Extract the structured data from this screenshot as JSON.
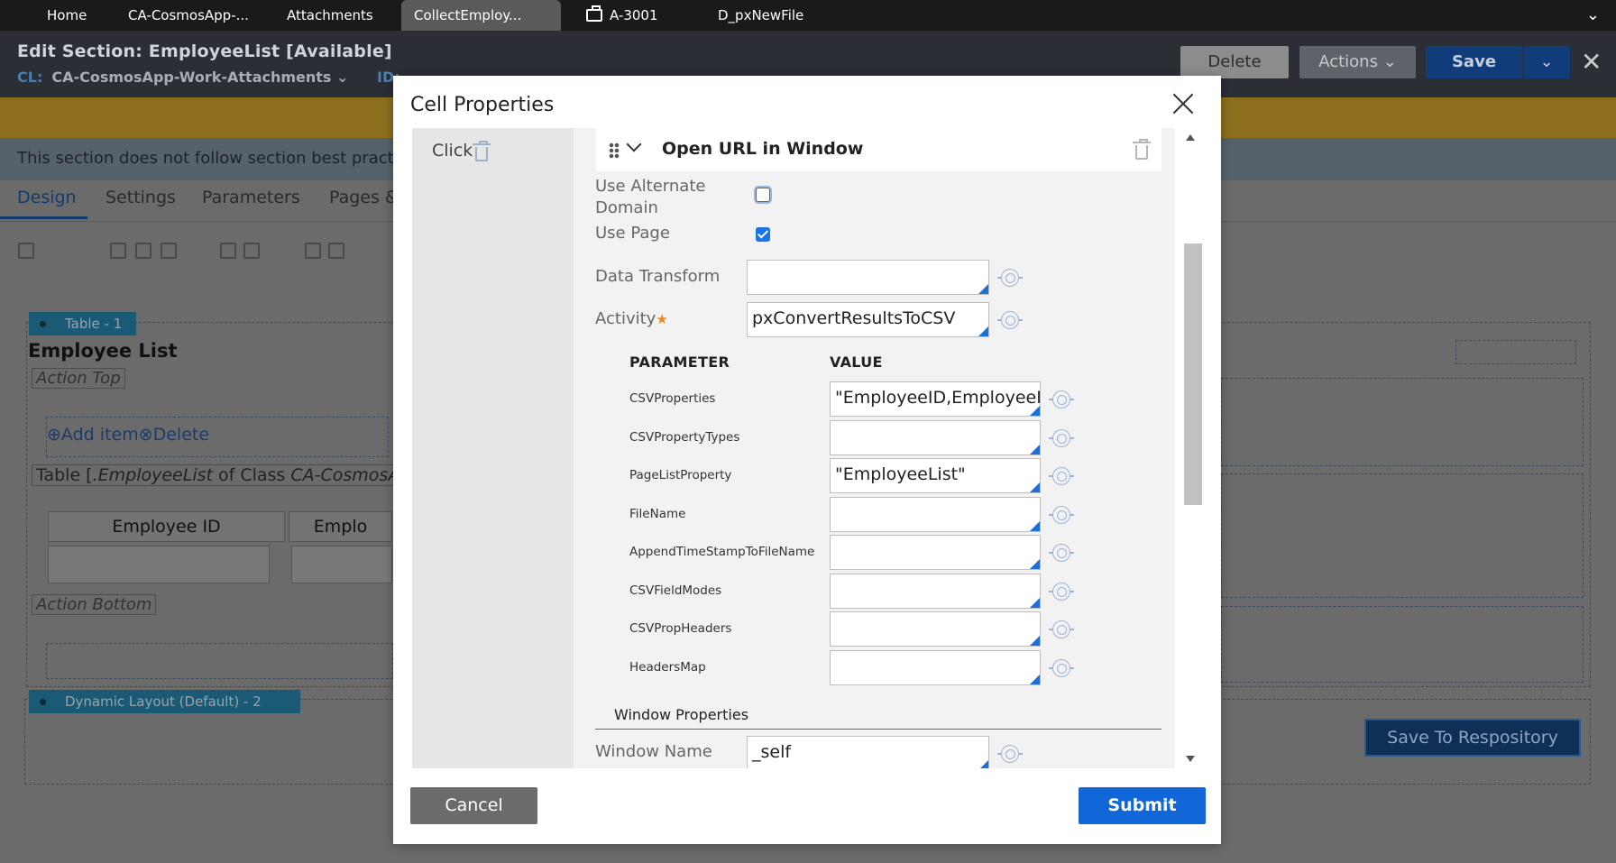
{
  "tabs": [
    {
      "label": "Home"
    },
    {
      "label": "CA-CosmosApp-..."
    },
    {
      "label": "Attachments"
    },
    {
      "label": "CollectEmploy..."
    },
    {
      "label": "A-3001"
    },
    {
      "label": "D_pxNewFile"
    }
  ],
  "header": {
    "title": "Edit  Section: EmployeeList [Available]",
    "cl_key": "CL:",
    "cl_value": "CA-CosmosApp-Work-Attachments",
    "id_key": "ID:",
    "delete_label": "Delete",
    "actions_label": "Actions",
    "save_label": "Save"
  },
  "info_text": "This section does not follow section best practic",
  "subtabs": [
    "Design",
    "Settings",
    "Parameters",
    "Pages &"
  ],
  "background": {
    "table_tag": "Table -    1",
    "employee_list": "Employee List",
    "action_top": "Action Top",
    "add_item": "Add item",
    "delete": "Delete",
    "table_desc_prefix": "Table [",
    "table_desc_prop": ".EmployeeList",
    "table_desc_mid": " of Class ",
    "table_desc_class": "CA-CosmosApp-",
    "col_employee_id": "Employee ID",
    "col_emplo": "Emplo",
    "action_bottom": "Action Bottom",
    "dyn_tag": "Dynamic Layout (Default) -    2",
    "save_repo": "Save To Respository"
  },
  "modal": {
    "title": "Cell Properties",
    "click_label": "Click",
    "action_title": "Open URL in Window",
    "use_alt_domain": "Use Alternate Domain",
    "use_page": "Use Page",
    "data_transform": "Data Transform",
    "data_transform_value": "",
    "activity": "Activity",
    "activity_value": "pxConvertResultsToCSV",
    "param_header": "PARAMETER",
    "value_header": "VALUE",
    "params": [
      {
        "name": "CSVProperties",
        "value": "\"EmployeeID,EmployeeNa"
      },
      {
        "name": "CSVPropertyTypes",
        "value": ""
      },
      {
        "name": "PageListProperty",
        "value": "\"EmployeeList\""
      },
      {
        "name": "FileName",
        "value": ""
      },
      {
        "name": "AppendTimeStampToFileName",
        "value": ""
      },
      {
        "name": "CSVFieldModes",
        "value": ""
      },
      {
        "name": "CSVPropHeaders",
        "value": ""
      },
      {
        "name": "HeadersMap",
        "value": ""
      }
    ],
    "window_props": "Window Properties",
    "window_name": "Window Name",
    "window_name_value": "_self",
    "cancel_label": "Cancel",
    "submit_label": "Submit"
  }
}
